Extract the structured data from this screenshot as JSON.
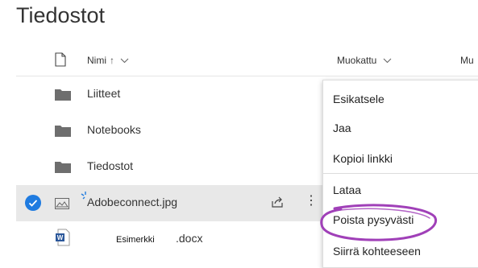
{
  "page": {
    "title": "Tiedostot"
  },
  "columns": {
    "name": "Nimi",
    "name_sort_arrow": "↑",
    "modified": "Muokattu",
    "modified_by_partial": "Mu"
  },
  "rows": [
    {
      "name": "Liitteet",
      "type": "folder"
    },
    {
      "name": "Notebooks",
      "type": "folder"
    },
    {
      "name": "Tiedostot",
      "type": "folder"
    },
    {
      "name": "Adobeconnect.jpg",
      "type": "image",
      "selected": true
    },
    {
      "name_overlay": "Esimerkki",
      "name_suffix": ".docx",
      "type": "word"
    }
  ],
  "context_menu": {
    "items": [
      "Esikatsele",
      "Jaa",
      "Kopioi linkki",
      "Lataa",
      "Poista pysyvästi",
      "Siirrä kohteeseen"
    ],
    "highlighted_item": "Poista pysyvästi"
  },
  "colors": {
    "accent_blue": "#1f7be0",
    "selected_row": "#e8e8e8",
    "annotation_purple": "#a040b8",
    "folder_gray": "#6e6e6e"
  },
  "icons": {
    "header_file": "document-icon",
    "folder": "folder-icon",
    "image": "image-file-icon",
    "share": "share-icon",
    "more": "more-vertical-icon",
    "word": "word-document-icon",
    "check": "checkmark-circle-icon",
    "new": "new-item-sparkle-icon"
  }
}
